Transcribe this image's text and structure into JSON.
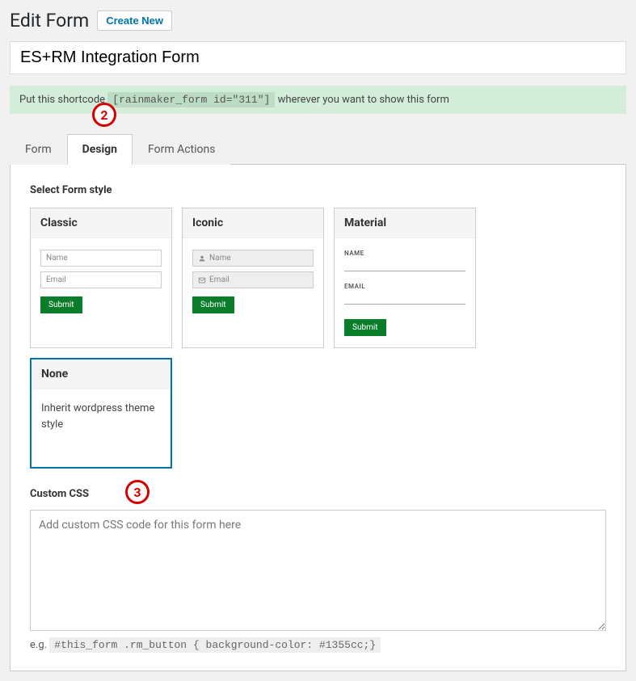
{
  "header": {
    "title": "Edit Form",
    "create_new": "Create New"
  },
  "form_title": "ES+RM Integration Form",
  "shortcode": {
    "prefix": "Put this shortcode ",
    "code": "[rainmaker_form id=\"311\"]",
    "suffix": " wherever you want to show this form"
  },
  "annotations": {
    "a2": "2",
    "a3": "3"
  },
  "tabs": {
    "form": "Form",
    "design": "Design",
    "actions": "Form Actions"
  },
  "style_section": {
    "label": "Select Form style",
    "classic": {
      "title": "Classic",
      "name": "Name",
      "email": "Email",
      "submit": "Submit"
    },
    "iconic": {
      "title": "Iconic",
      "name": "Name",
      "email": "Email",
      "submit": "Submit"
    },
    "material": {
      "title": "Material",
      "name": "NAME",
      "email": "EMAIL",
      "submit": "Submit"
    },
    "none": {
      "title": "None",
      "desc": "Inherit wordpress theme style"
    }
  },
  "css": {
    "label": "Custom CSS",
    "placeholder": "Add custom CSS code for this form here",
    "hint_prefix": "e.g. ",
    "hint_code": "#this_form .rm_button { background-color: #1355cc;}"
  }
}
